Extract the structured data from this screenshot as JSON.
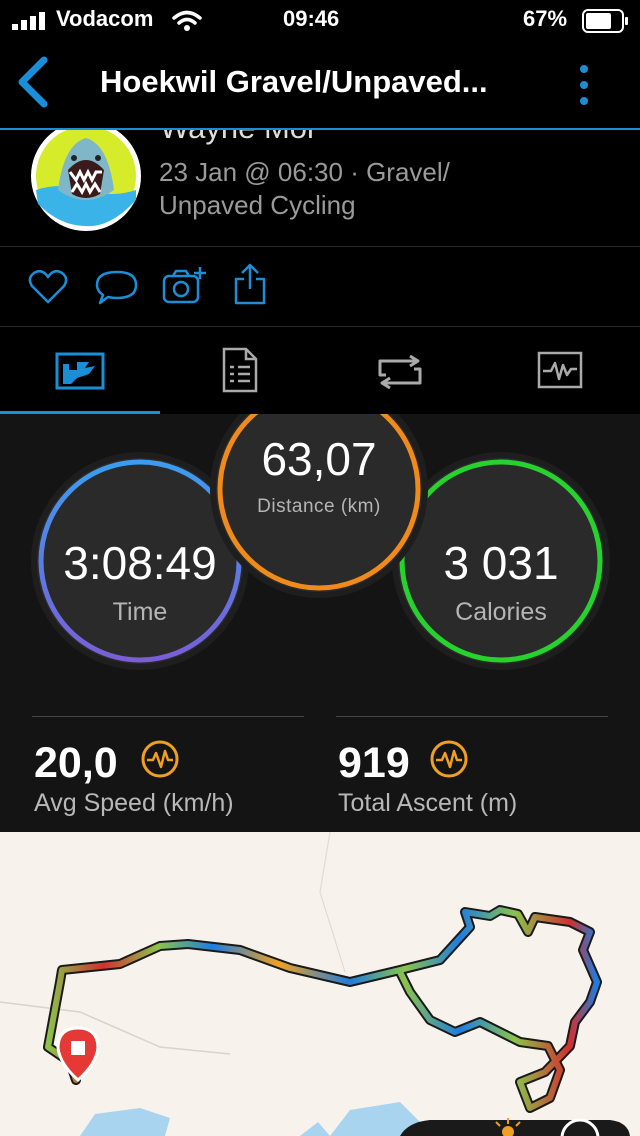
{
  "status_bar": {
    "carrier": "Vodacom",
    "time": "09:46",
    "battery": "67%"
  },
  "nav": {
    "title": "Hoekwil Gravel/Unpaved..."
  },
  "profile": {
    "name": "Wayne Moi",
    "meta": "23 Jan @ 06:30 · Gravel/ Unpaved Cycling"
  },
  "stats": {
    "time": {
      "value": "3:08:49",
      "label": "Time"
    },
    "distance": {
      "value": "63,07",
      "label": "Distance (km)"
    },
    "calories": {
      "value": "3 031",
      "label": "Calories"
    },
    "avg_speed": {
      "value": "20,0",
      "label": "Avg Speed (km/h)"
    },
    "total_ascent": {
      "value": "919",
      "label": "Total Ascent (m)"
    }
  },
  "colors": {
    "accent": "#1a8fd8",
    "time_ring": "#4a7fe0",
    "distance_ring": "#f08a1a",
    "calories_ring": "#27d12e",
    "badge": "#f0a020"
  },
  "icons": {
    "back": "chevron-left-icon",
    "more": "vertical-dots-icon",
    "like": "heart-icon",
    "comment": "speech-bubble-icon",
    "photo": "camera-plus-icon",
    "share": "share-icon",
    "overview_tab": "chart-card-icon",
    "details_tab": "document-list-icon",
    "laps_tab": "loop-arrow-icon",
    "graphs_tab": "pulse-graph-icon"
  }
}
